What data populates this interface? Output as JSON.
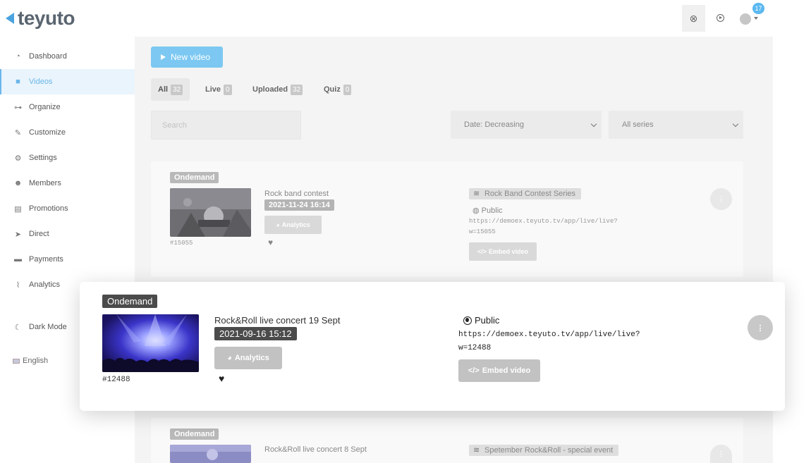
{
  "brand": {
    "name": "teyuto",
    "accent": "#4aa3df"
  },
  "header": {
    "notifications_count": "17"
  },
  "sidebar": {
    "items": [
      {
        "label": "Dashboard",
        "icon": "tachometer-icon",
        "glyph": "◔"
      },
      {
        "label": "Videos",
        "icon": "video-camera-icon",
        "glyph": "■"
      },
      {
        "label": "Organize",
        "icon": "sitemap-icon",
        "glyph": "⊶"
      },
      {
        "label": "Customize",
        "icon": "brush-icon",
        "glyph": "✎"
      },
      {
        "label": "Settings",
        "icon": "cogs-icon",
        "glyph": "⚙"
      },
      {
        "label": "Members",
        "icon": "users-icon",
        "glyph": "☻"
      },
      {
        "label": "Promotions",
        "icon": "ticket-icon",
        "glyph": "▤"
      },
      {
        "label": "Direct",
        "icon": "paper-plane-icon",
        "glyph": "➤"
      },
      {
        "label": "Payments",
        "icon": "wallet-icon",
        "glyph": "▬"
      },
      {
        "label": "Analytics",
        "icon": "line-chart-icon",
        "glyph": "⌇"
      }
    ],
    "dark_mode_label": "Dark Mode",
    "language_label": "English"
  },
  "toolbar": {
    "new_video_label": "New video"
  },
  "tabs": [
    {
      "label": "All",
      "count": "32"
    },
    {
      "label": "Live",
      "count": "0"
    },
    {
      "label": "Uploaded",
      "count": "32"
    },
    {
      "label": "Quiz",
      "count": "0"
    }
  ],
  "filters": {
    "search_placeholder": "Search",
    "sort_value": "Date: Decreasing",
    "series_value": "All series"
  },
  "videos": [
    {
      "type": "Ondemand",
      "title": "Rock band contest",
      "date": "2021-11-24 16:14",
      "id": "#15055",
      "series": "Rock Band Contest Series",
      "privacy": "Public",
      "url_line1": "https://demoex.teyuto.tv/app/live/live?",
      "url_line2": "w=15055",
      "analytics_label": "Analytics",
      "embed_label": "Embed video"
    },
    {
      "type": "Ondemand",
      "title": "Rock&Roll live concert 19 Sept",
      "date": "2021-09-16 15:12",
      "id": "#12488",
      "privacy": "Public",
      "url_line1": "https://demoex.teyuto.tv/app/live/live?",
      "url_line2": "w=12488",
      "analytics_label": "Analytics",
      "embed_label": "Embed video"
    },
    {
      "type": "Ondemand",
      "title": "Rock&Roll live concert 8 Sept",
      "series": "Spetember Rock&Roll - special event"
    }
  ]
}
